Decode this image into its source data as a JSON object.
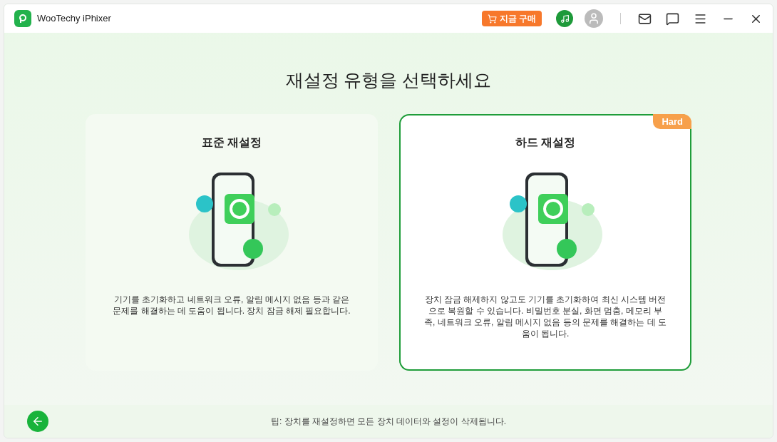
{
  "window": {
    "title": "WooTechy iPhixer"
  },
  "buy_button": "지금 구매",
  "heading": "재설정 유형을 선택하세요",
  "cards": [
    {
      "title": "표준 재설정",
      "description": "기기를 초기화하고 네트워크 오류, 알림 메시지 없음 등과 같은 문제를 해결하는 데 도움이 됩니다. 장치 잠금 해제 필요합니다.",
      "selected": false
    },
    {
      "title": "하드 재설정",
      "badge": "Hard",
      "description": "장치 잠금 해제하지 않고도 기기를 초기화하여 최신 시스템 버전으로 복원할 수 있습니다. 비밀번호 분실, 화면 멈춤, 메모리 부족, 네트워크 오류, 알림 메시지 없음 등의 문제를 해결하는 데 도움이 됩니다.",
      "selected": true
    }
  ],
  "tip": "팁: 장치를 재설정하면 모든 장치 데이터와 설정이 삭제됩니다."
}
